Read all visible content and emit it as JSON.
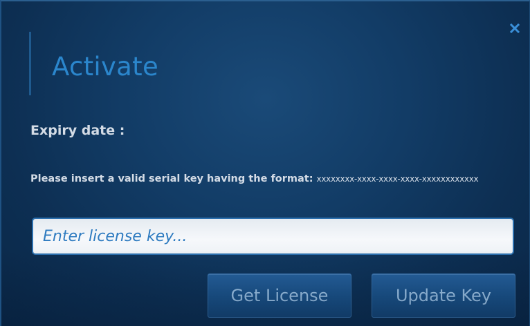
{
  "dialog": {
    "title": "Activate",
    "close_icon": "close-icon"
  },
  "expiry": {
    "label": "Expiry date :",
    "value": ""
  },
  "instructions": {
    "text": "Please insert a valid serial key having the format: ",
    "format": "xxxxxxxx-xxxx-xxxx-xxxx-xxxxxxxxxxxx"
  },
  "license_input": {
    "value": "",
    "placeholder": "Enter license key..."
  },
  "buttons": {
    "get_license": "Get License",
    "update_key": "Update Key"
  },
  "colors": {
    "background": "#123c66",
    "title": "#2b86cc",
    "button_text": "#a8cff2",
    "input_border": "#2b6fae"
  }
}
